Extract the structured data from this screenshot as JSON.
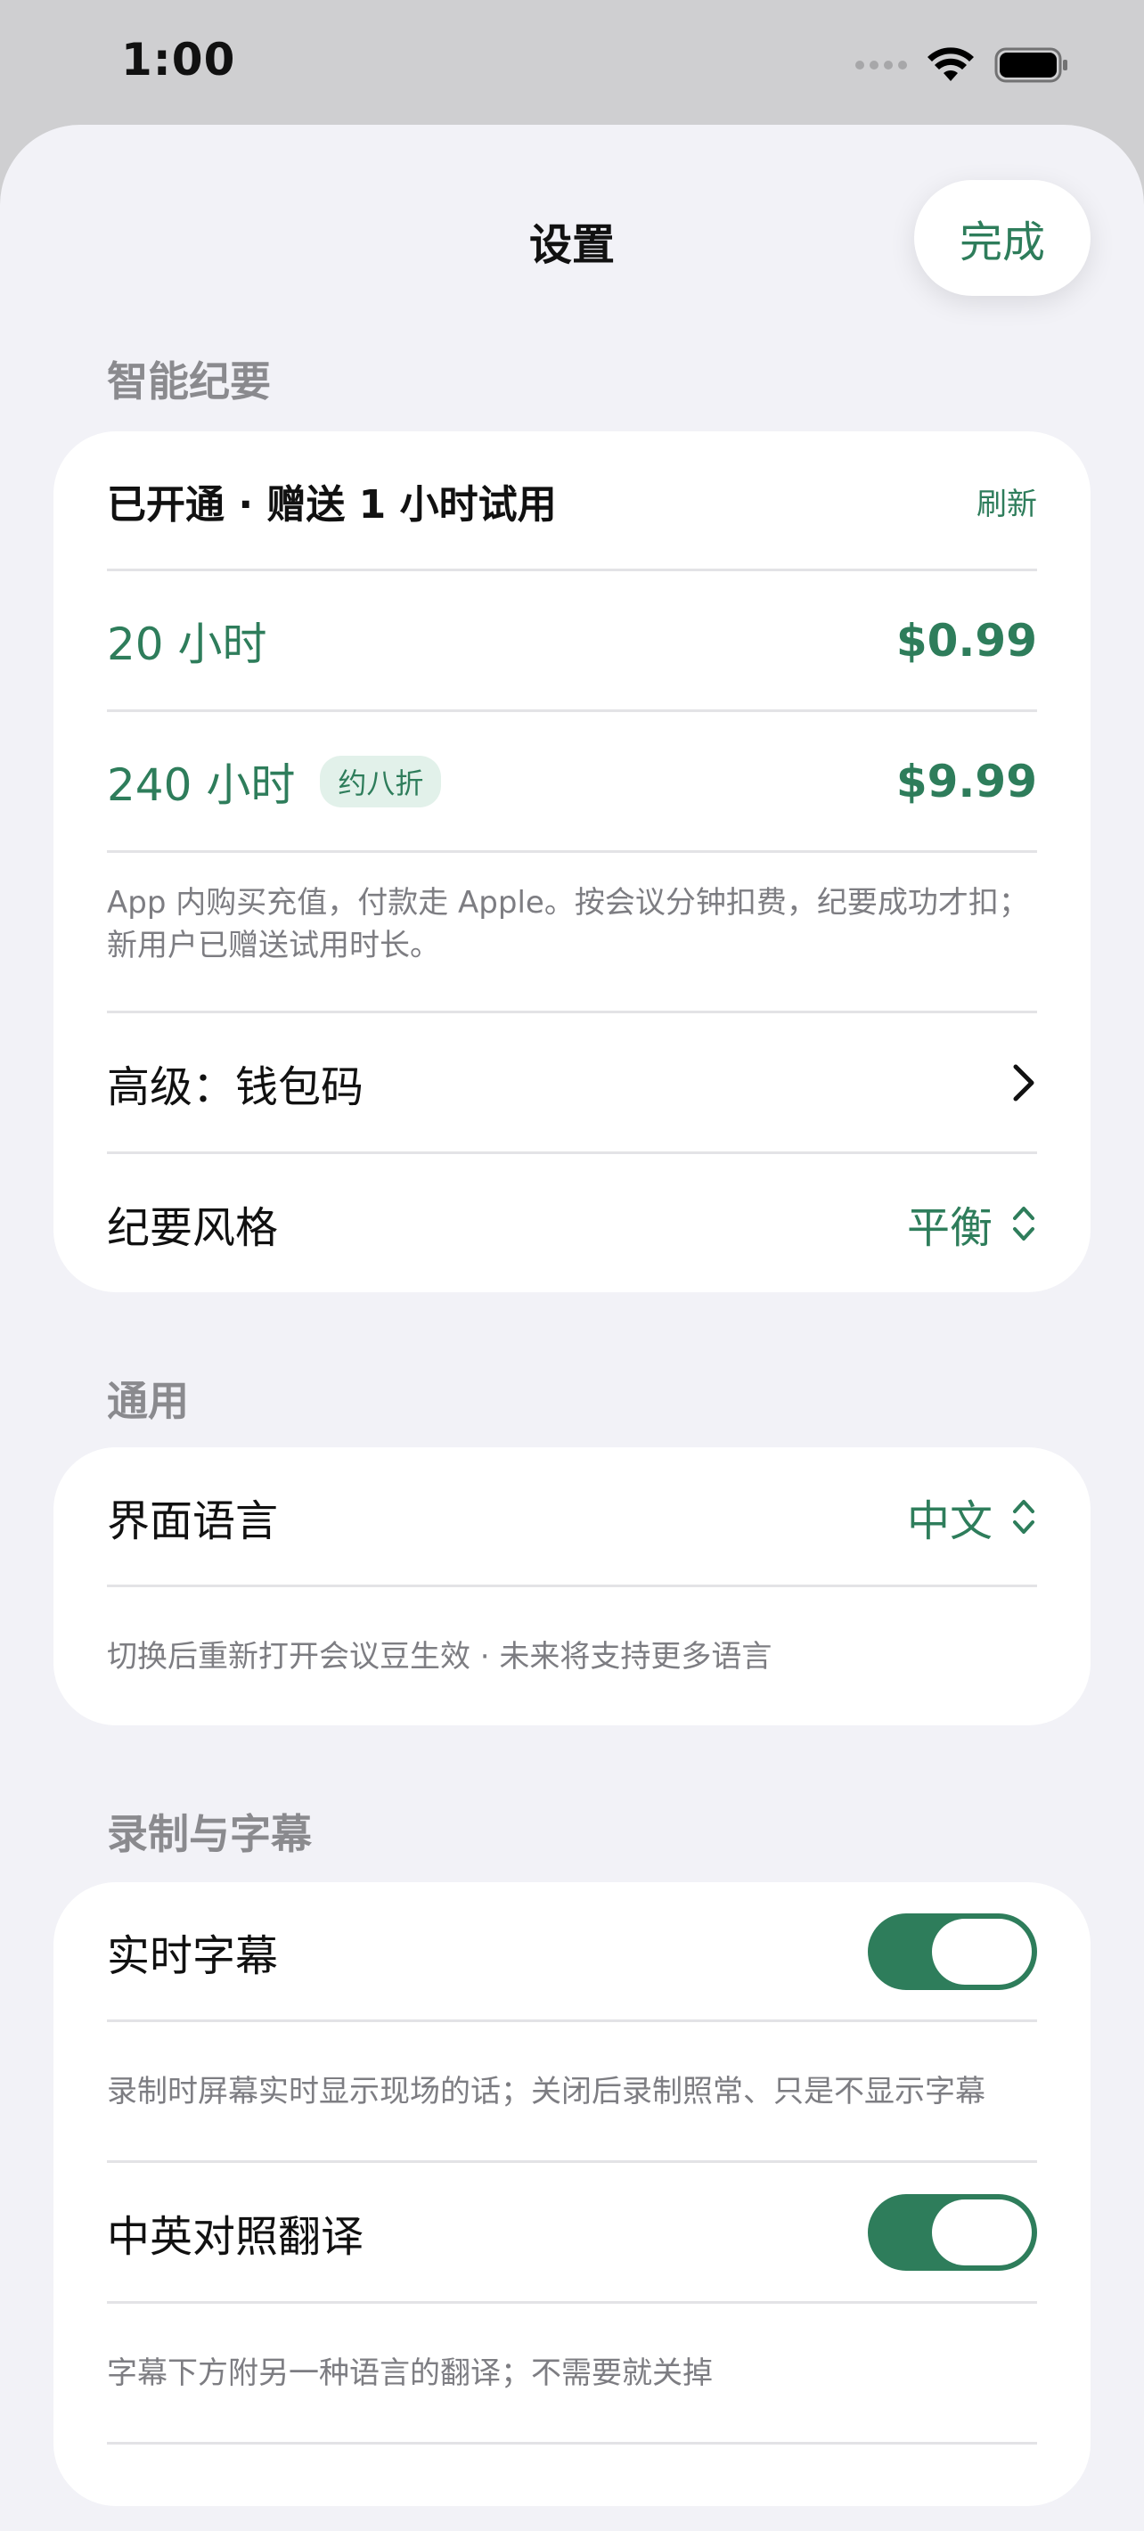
{
  "status": {
    "time": "1:00",
    "icons": [
      "signal-dots-icon",
      "wifi-icon",
      "battery-icon"
    ]
  },
  "nav": {
    "title": "设置",
    "done_label": "完成"
  },
  "sections": {
    "smart": {
      "label": "智能纪要",
      "plan_status": "已开通 · 赠送 1 小时试用",
      "refresh": "刷新",
      "plans": [
        {
          "name": "20 小时",
          "price": "$0.99"
        },
        {
          "name": "240 小时",
          "badge": "约八折",
          "price": "$9.99"
        }
      ],
      "note": "App 内购买充值，付款走 Apple。按会议分钟扣费，纪要成功才扣；新用户已赠送试用时长。",
      "advanced": "高级：钱包码",
      "style_label": "纪要风格",
      "style_value": "平衡"
    },
    "general": {
      "label": "通用",
      "language_label": "界面语言",
      "language_value": "中文",
      "note": "切换后重新打开会议豆生效 · 未来将支持更多语言"
    },
    "recording": {
      "label": "录制与字幕",
      "live_caption": "实时字幕",
      "live_caption_on": true,
      "live_caption_note": "录制时屏幕实时显示现场的话；关闭后录制照常、只是不显示字幕",
      "translation": "中英对照翻译",
      "translation_on": true,
      "translation_note": "字幕下方附另一种语言的翻译；不需要就关掉"
    }
  },
  "colors": {
    "accent": "#2e7d5b",
    "background": "#f2f2f7"
  }
}
